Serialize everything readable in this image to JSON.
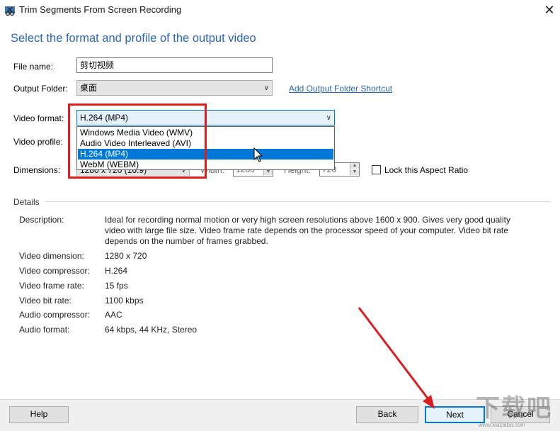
{
  "window": {
    "title": "Trim Segments From Screen Recording",
    "close_glyph": "✕"
  },
  "heading": "Select the format and profile of the output video",
  "form": {
    "file_name_label": "File name:",
    "file_name_value": "剪切视频",
    "output_folder_label": "Output Folder:",
    "output_folder_value": "桌面",
    "add_shortcut_link": "Add Output Folder Shortcut",
    "video_format_label": "Video format:",
    "video_format_value": "H.264 (MP4)",
    "video_profile_label": "Video profile:",
    "dimensions_label": "Dimensions:",
    "dimensions_value": "1280 x 720 (16:9)",
    "width_label": "Width:",
    "width_value": "1280",
    "height_label": "Height:",
    "height_value": "720",
    "aspect_label": "Lock this Aspect Ratio"
  },
  "dropdown": {
    "options": [
      "Windows Media Video (WMV)",
      "Audio Video Interleaved (AVI)",
      "H.264 (MP4)",
      "WebM (WEBM)"
    ],
    "selected_index": 2
  },
  "details": {
    "section_label": "Details",
    "description_label": "Description:",
    "description_lines": [
      "Ideal for recording normal motion or very high screen resolutions above 1600 x 900.  Gives very good quality",
      "video with large file size. Video frame rate depends on the processor speed of your computer. Video bit rate",
      "depends on the number of frames grabbed."
    ],
    "rows": [
      {
        "label": "Video dimension:",
        "value": "1280 x 720"
      },
      {
        "label": "Video compressor:",
        "value": "H.264"
      },
      {
        "label": "Video frame rate:",
        "value": "15 fps"
      },
      {
        "label": "Video bit rate:",
        "value": "1100 kbps"
      },
      {
        "label": "Audio compressor:",
        "value": "AAC"
      },
      {
        "label": "Audio format:",
        "value": "64 kbps, 44 KHz, Stereo"
      }
    ]
  },
  "buttons": {
    "help": "Help",
    "back": "Back",
    "next": "Next",
    "cancel": "Cancel"
  },
  "watermark": {
    "main": "下载吧",
    "sub": "www.xiazaiba.com"
  },
  "colors": {
    "accent": "#0078d7",
    "heading": "#2a66b3",
    "annotation": "#e01d1d"
  }
}
